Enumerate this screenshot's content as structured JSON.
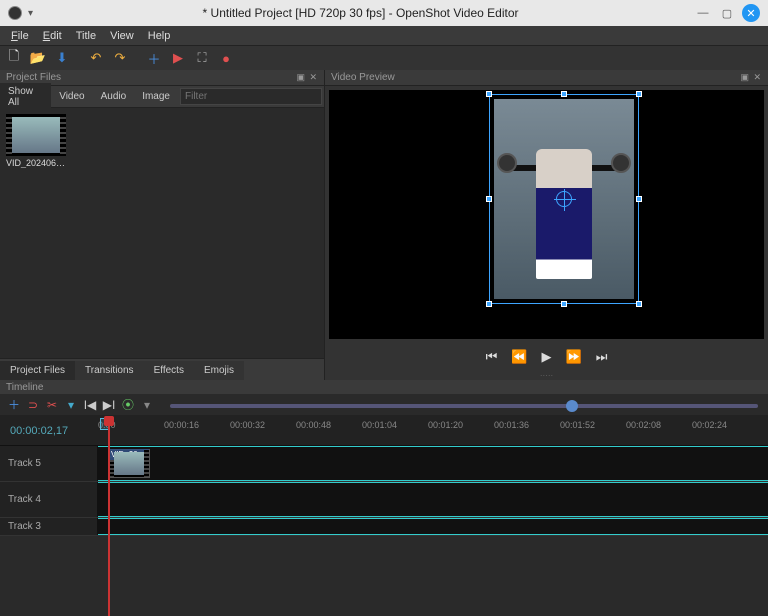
{
  "window": {
    "title": "* Untitled Project [HD 720p 30 fps] - OpenShot Video Editor"
  },
  "menu": {
    "file": "File",
    "edit": "Edit",
    "title": "Title",
    "view": "View",
    "help": "Help"
  },
  "panels": {
    "projectFiles": "Project Files",
    "videoPreview": "Video Preview",
    "timeline": "Timeline"
  },
  "filterTabs": {
    "all": "Show All",
    "video": "Video",
    "audio": "Audio",
    "image": "Image"
  },
  "filter": {
    "placeholder": "Filter"
  },
  "files": [
    {
      "name": "VID_202406231..."
    }
  ],
  "bottomTabs": {
    "pf": "Project Files",
    "tr": "Transitions",
    "ef": "Effects",
    "em": "Emojis"
  },
  "ruler": {
    "timecode": "00:00:02,17",
    "ticks": [
      "0:00",
      "00:00:16",
      "00:00:32",
      "00:00:48",
      "00:01:04",
      "00:01:20",
      "00:01:36",
      "00:01:52",
      "00:02:08",
      "00:02:24"
    ]
  },
  "tracks": {
    "t5": "Track 5",
    "t4": "Track 4",
    "t3": "Track 3"
  },
  "clip": {
    "label": "VID_20..."
  }
}
